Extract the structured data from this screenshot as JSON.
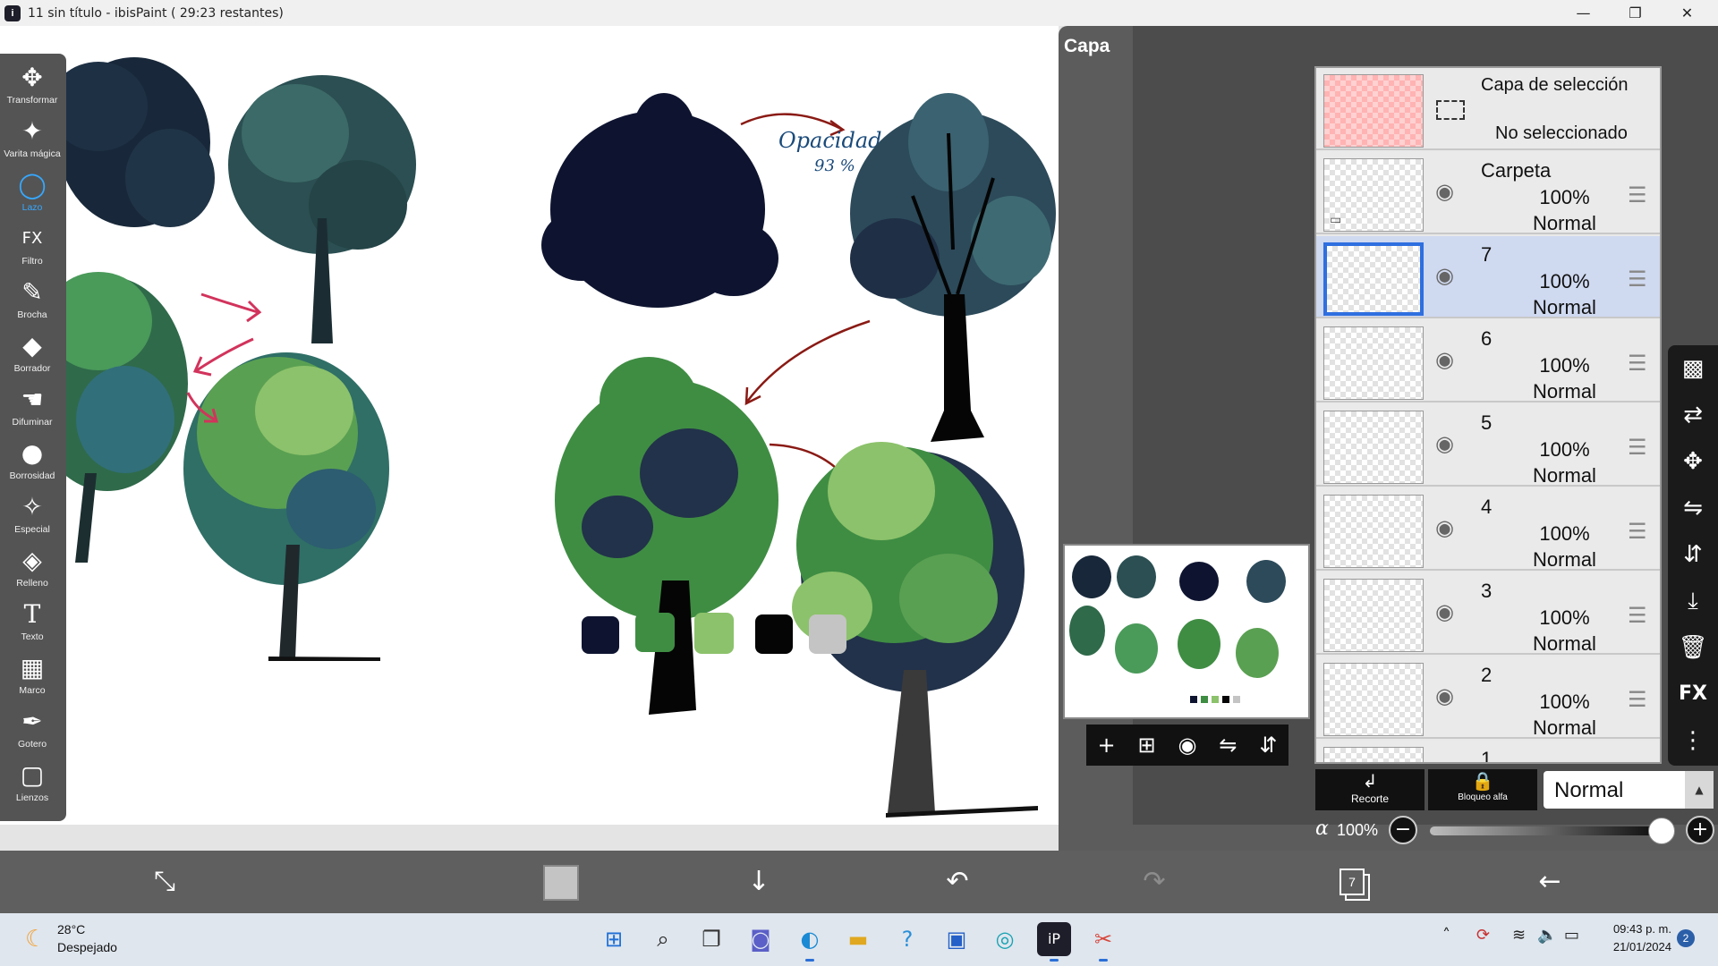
{
  "window": {
    "title": "11 sin título - ibisPaint ( 29:23 restantes)",
    "controls": {
      "minimize": "—",
      "restore": "❐",
      "close": "✕"
    }
  },
  "toolbar": {
    "active_tool": "Lazo",
    "tools": [
      {
        "label": "Transformar",
        "icon": "move-arrows-icon",
        "glyph": "✥"
      },
      {
        "label": "Varita mágica",
        "icon": "magic-wand-icon",
        "glyph": "✦"
      },
      {
        "label": "Lazo",
        "icon": "lasso-icon",
        "glyph": "◯"
      },
      {
        "label": "Filtro",
        "icon": "fx-filter-icon",
        "glyph": "FX"
      },
      {
        "label": "Brocha",
        "icon": "brush-icon",
        "glyph": "✎"
      },
      {
        "label": "Borrador",
        "icon": "eraser-icon",
        "glyph": "◆"
      },
      {
        "label": "Difuminar",
        "icon": "smudge-icon",
        "glyph": "☚"
      },
      {
        "label": "Borrosidad",
        "icon": "blur-drop-icon",
        "glyph": "●"
      },
      {
        "label": "Especial",
        "icon": "special-wand-icon",
        "glyph": "✧"
      },
      {
        "label": "Relleno",
        "icon": "fill-bucket-icon",
        "glyph": "◈"
      },
      {
        "label": "Texto",
        "icon": "text-icon",
        "glyph": "T"
      },
      {
        "label": "Marco",
        "icon": "frame-icon",
        "glyph": "▦"
      },
      {
        "label": "Gotero",
        "icon": "eyedropper-icon",
        "glyph": "✒"
      },
      {
        "label": "Lienzos",
        "icon": "canvas-icon",
        "glyph": "▢"
      }
    ]
  },
  "canvas": {
    "annotation_line1": "Opacidad",
    "annotation_line2": "93 %",
    "palette": [
      "#0e1430",
      "#3f8d43",
      "#8cc26b",
      "#050505",
      "#c4c4c4"
    ]
  },
  "layer_panel": {
    "title": "Capa",
    "selection_layer": {
      "title": "Capa de selección",
      "status": "No seleccionado"
    },
    "layers": [
      {
        "name": "Carpeta",
        "opacity": "100%",
        "blend": "Normal",
        "folder": true,
        "selected": false
      },
      {
        "name": "7",
        "opacity": "100%",
        "blend": "Normal",
        "folder": false,
        "selected": true
      },
      {
        "name": "6",
        "opacity": "100%",
        "blend": "Normal",
        "folder": false,
        "selected": false
      },
      {
        "name": "5",
        "opacity": "100%",
        "blend": "Normal",
        "folder": false,
        "selected": false
      },
      {
        "name": "4",
        "opacity": "100%",
        "blend": "Normal",
        "folder": false,
        "selected": false
      },
      {
        "name": "3",
        "opacity": "100%",
        "blend": "Normal",
        "folder": false,
        "selected": false
      },
      {
        "name": "2",
        "opacity": "100%",
        "blend": "Normal",
        "folder": false,
        "selected": false
      },
      {
        "name": "1",
        "opacity": "",
        "blend": "",
        "folder": false,
        "selected": false
      }
    ],
    "side_icons": [
      {
        "icon": "transparency-checker-icon",
        "glyph": "▩"
      },
      {
        "icon": "layer-transfer-icon",
        "glyph": "⇄"
      },
      {
        "icon": "move-layer-icon",
        "glyph": "✥"
      },
      {
        "icon": "flip-horizontal-icon",
        "glyph": "⇋"
      },
      {
        "icon": "flip-vertical-icon",
        "glyph": "⇵"
      },
      {
        "icon": "merge-down-icon",
        "glyph": "⤓"
      },
      {
        "icon": "trash-icon",
        "glyph": "🗑"
      },
      {
        "icon": "fx-layer-icon",
        "glyph": "FX"
      },
      {
        "icon": "more-options-icon",
        "glyph": "⋮"
      }
    ],
    "preview_buttons": [
      {
        "icon": "add-layer-icon",
        "glyph": "+"
      },
      {
        "icon": "add-layer-square-icon",
        "glyph": "⊞"
      },
      {
        "icon": "camera-icon",
        "glyph": "◉"
      },
      {
        "icon": "flip-preview-icon",
        "glyph": "⇋"
      },
      {
        "icon": "collapse-preview-icon",
        "glyph": "⇵"
      }
    ],
    "clip_label": "Recorte",
    "alpha_lock_label": "Bloqueo alfa",
    "blend_mode": "Normal",
    "alpha_symbol": "α",
    "alpha_value": "100%",
    "alpha_fraction": 1.0
  },
  "navbar": {
    "layer_count": "7",
    "buttons": [
      {
        "icon": "brush-settings-icon",
        "glyph": "⤡"
      },
      {
        "icon": "download-arrow-icon",
        "glyph": "↓"
      },
      {
        "icon": "undo-icon",
        "glyph": "↶"
      },
      {
        "icon": "redo-icon",
        "glyph": "↷"
      },
      {
        "icon": "back-arrow-icon",
        "glyph": "←"
      }
    ]
  },
  "taskbar": {
    "weather_temp": "28°C",
    "weather_desc": "Despejado",
    "clock_time": "09:43 p. m.",
    "clock_date": "21/01/2024",
    "notifications": "2"
  }
}
